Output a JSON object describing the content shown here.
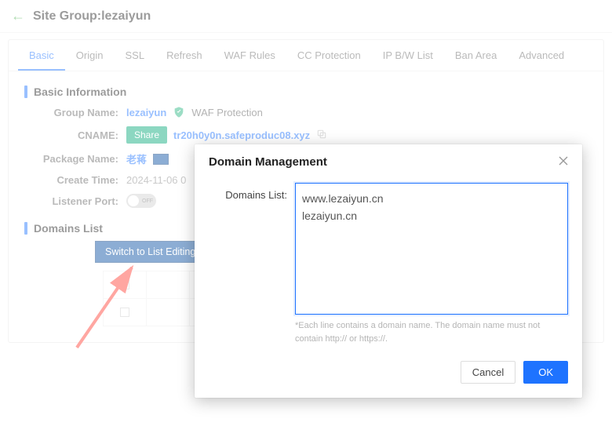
{
  "header": {
    "title": "Site Group:lezaiyun"
  },
  "tabs": [
    "Basic",
    "Origin",
    "SSL",
    "Refresh",
    "WAF Rules",
    "CC Protection",
    "IP B/W List",
    "Ban Area",
    "Advanced"
  ],
  "activeTab": 0,
  "sections": {
    "basic": "Basic Information",
    "domains": "Domains List"
  },
  "info": {
    "groupName": {
      "label": "Group Name:",
      "value": "lezaiyun"
    },
    "waf_badge": "WAF Protection",
    "cname": {
      "label": "CNAME:",
      "share": "Share",
      "value": "tr20h0y0n.safeproduc08.xyz"
    },
    "packageName": {
      "label": "Package Name:",
      "value": "老蒋"
    },
    "createTime": {
      "label": "Create Time:",
      "value": "2024-11-06 0"
    },
    "listenerPort": {
      "label": "Listener Port:",
      "state": "OFF"
    }
  },
  "domainsList": {
    "switchBtn": "Switch to List Editing"
  },
  "modal": {
    "title": "Domain Management",
    "domainsLabel": "Domains List:",
    "domainsValue": "www.lezaiyun.cn\nlezaiyun.cn",
    "hint": "*Each line contains a domain name. The domain name must not contain http:// or https://.",
    "cancel": "Cancel",
    "ok": "OK"
  }
}
